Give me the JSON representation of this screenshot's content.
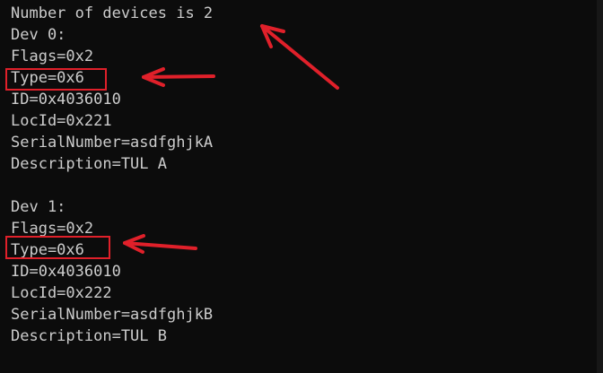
{
  "terminal": {
    "lines": [
      "Number of devices is 2",
      "Dev 0:",
      "Flags=0x2",
      "Type=0x6",
      "ID=0x4036010",
      "LocId=0x221",
      "SerialNumber=asdfghjkA",
      "Description=TUL A",
      "",
      "Dev 1:",
      "Flags=0x2",
      "Type=0x6",
      "ID=0x4036010",
      "LocId=0x222",
      "SerialNumber=asdfghjkB",
      "Description=TUL B"
    ]
  },
  "annotations": {
    "color": "#e0202a",
    "highlight_boxes": [
      "dev0-type-line",
      "dev1-type-line"
    ],
    "arrows": [
      "arrow-to-device-count",
      "arrow-to-dev0-type",
      "arrow-to-dev1-type"
    ]
  }
}
